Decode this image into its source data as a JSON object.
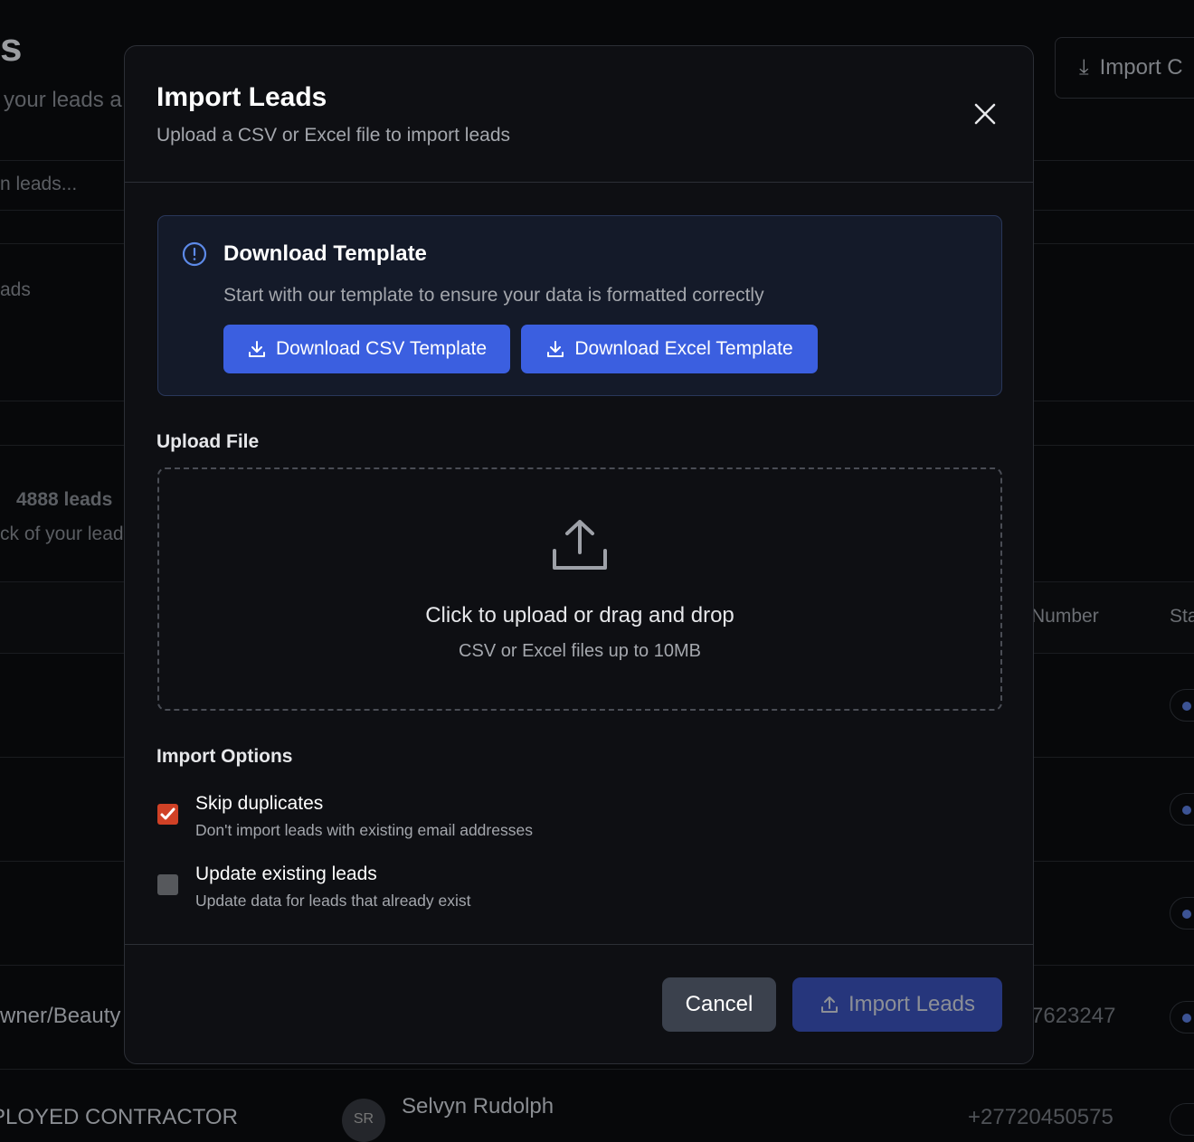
{
  "background": {
    "title_fragment": "s",
    "subtitle_fragment": "your leads a",
    "search_fragment": "n leads...",
    "section_fragment": "ads",
    "count": "4888 leads",
    "desc_fragment": "ck of your lead",
    "import_button_fragment": "Import C",
    "col_number": "Number",
    "col_status": "Sta",
    "row_job_fragment": "wner/Beauty",
    "row_phone_fragment": "7623247",
    "next_row_job": "PLOYED CONTRACTOR",
    "next_row_avatar": "SR",
    "next_row_name": "Selvyn Rudolph",
    "next_row_phone": "+27720450575"
  },
  "modal": {
    "title": "Import Leads",
    "subtitle": "Upload a CSV or Excel file to import leads",
    "template": {
      "title": "Download Template",
      "description": "Start with our template to ensure your data is formatted correctly",
      "csv_button": "Download CSV Template",
      "excel_button": "Download Excel Template"
    },
    "upload": {
      "label": "Upload File",
      "primary": "Click to upload or drag and drop",
      "secondary": "CSV or Excel files up to 10MB"
    },
    "options": {
      "label": "Import Options",
      "items": [
        {
          "label": "Skip duplicates",
          "description": "Don't import leads with existing email addresses",
          "checked": true
        },
        {
          "label": "Update existing leads",
          "description": "Update data for leads that already exist",
          "checked": false
        }
      ]
    },
    "cancel": "Cancel",
    "import": "Import Leads"
  },
  "colors": {
    "accent": "#3b5fe0",
    "checkbox": "#d04126"
  }
}
